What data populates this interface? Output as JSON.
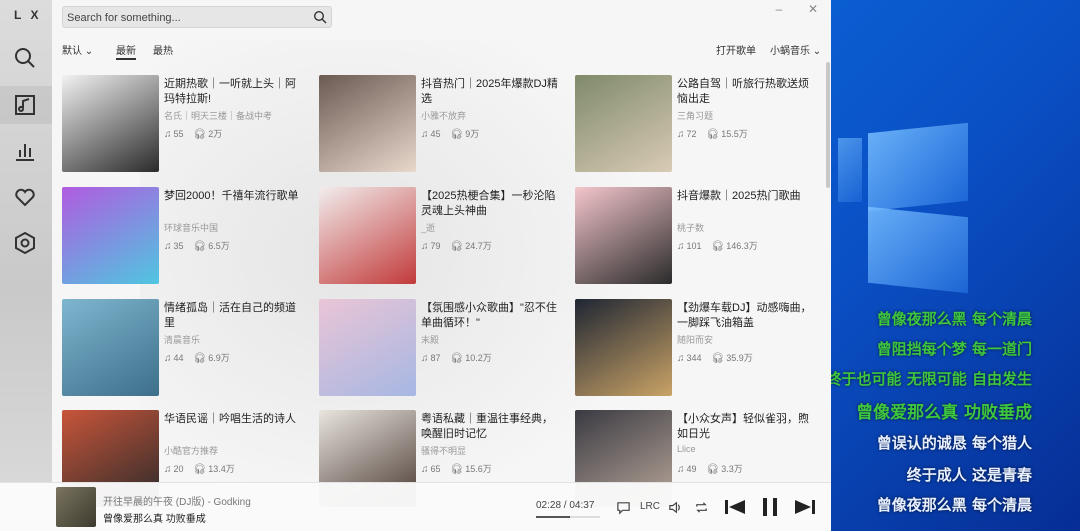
{
  "app": {
    "logo": "L X",
    "search_placeholder": "Search for something...",
    "window_controls": {
      "minimize": "–",
      "close": "✕"
    }
  },
  "sidebar": {
    "items": [
      {
        "icon": "search-icon"
      },
      {
        "icon": "music-list-icon"
      },
      {
        "icon": "chart-icon"
      },
      {
        "icon": "heart-icon"
      },
      {
        "icon": "settings-icon"
      }
    ]
  },
  "tabs": {
    "sort": "默认",
    "latest": "最新",
    "hottest": "最热",
    "open_playlist": "打开歌单",
    "source": "小蜗音乐"
  },
  "playlists": [
    {
      "title": "近期热歌｜一听就上头｜阿玛特拉斯!",
      "author": "名氏｜明天三楼｜备战中考",
      "songs": "55",
      "plays": "2万",
      "c1": "#f2f2f2",
      "c2": "#2a2a2a"
    },
    {
      "title": "抖音热门｜2025年爆款DJ精选",
      "author": "小雅不放弃",
      "songs": "45",
      "plays": "9万",
      "c1": "#6b5a52",
      "c2": "#e8d8cc"
    },
    {
      "title": "公路自驾｜听旅行热歌送烦恼出走",
      "author": "三角习题",
      "songs": "72",
      "plays": "15.5万",
      "c1": "#7f8a6a",
      "c2": "#d9cbb5"
    },
    {
      "title": "梦回2000！千禧年流行歌单",
      "author": "环球音乐中国",
      "songs": "35",
      "plays": "6.5万",
      "c1": "#b15be0",
      "c2": "#4fc6e0"
    },
    {
      "title": "【2025热梗合集】一秒沦陷灵魂上头神曲",
      "author": "_逝",
      "songs": "79",
      "plays": "24.7万",
      "c1": "#f2eded",
      "c2": "#c23a3a"
    },
    {
      "title": "抖音爆款｜2025热门歌曲",
      "author": "桃子数",
      "songs": "101",
      "plays": "146.3万",
      "c1": "#f4c6cc",
      "c2": "#2b2b2b"
    },
    {
      "title": "情绪孤岛｜活在自己的频道里",
      "author": "清晨音乐",
      "songs": "44",
      "plays": "6.9万",
      "c1": "#7fb6cf",
      "c2": "#3d6f8a"
    },
    {
      "title": "【氛围感小众歌曲】\"忍不住单曲循环！\"",
      "author": "末殿",
      "songs": "87",
      "plays": "10.2万",
      "c1": "#eac5d6",
      "c2": "#a6b7e3"
    },
    {
      "title": "【劲爆车载DJ】动感嗨曲，一脚踩飞油箱盖",
      "author": "随阳而安",
      "songs": "344",
      "plays": "35.9万",
      "c1": "#1f2633",
      "c2": "#caa366"
    },
    {
      "title": "华语民谣｜吟唱生活的诗人",
      "author": "小酷官方推荐",
      "songs": "20",
      "plays": "13.4万",
      "c1": "#c8553a",
      "c2": "#2a2a2a"
    },
    {
      "title": "粤语私藏｜重温往事经典，唤醒旧时记忆",
      "author": "骚得不明显",
      "songs": "65",
      "plays": "15.6万",
      "c1": "#e9e5df",
      "c2": "#4a3a32"
    },
    {
      "title": "【小众女声】轻似雀羽，煦如日光",
      "author": "Llice",
      "songs": "49",
      "plays": "3.3万",
      "c1": "#3a3a42",
      "c2": "#b9a79a"
    }
  ],
  "player": {
    "song": "开往早晨的午夜 (DJ版) - Godking",
    "lyric": "曾像爱那么真 功败垂成",
    "time": "02:28 / 04:37",
    "progress": 0.53,
    "lrc_label": "LRC"
  },
  "desktop_lyrics": [
    {
      "text": "曾像夜那么黑 每个清晨",
      "color": "#3ec63e"
    },
    {
      "text": "曾阻挡每个梦 每一道门",
      "color": "#3ec63e"
    },
    {
      "text": "终于也可能 无限可能 自由发生",
      "color": "#3ec63e"
    },
    {
      "text": "曾像爱那么真 功败垂成",
      "color": "#3ec63e"
    },
    {
      "text": "曾误认的诚恳 每个猎人",
      "color": "#e8f0ff"
    },
    {
      "text": "终于成人 这是青春",
      "color": "#e8f0ff"
    },
    {
      "text": "曾像夜那么黑 每个清晨",
      "color": "#e8f0ff"
    }
  ]
}
